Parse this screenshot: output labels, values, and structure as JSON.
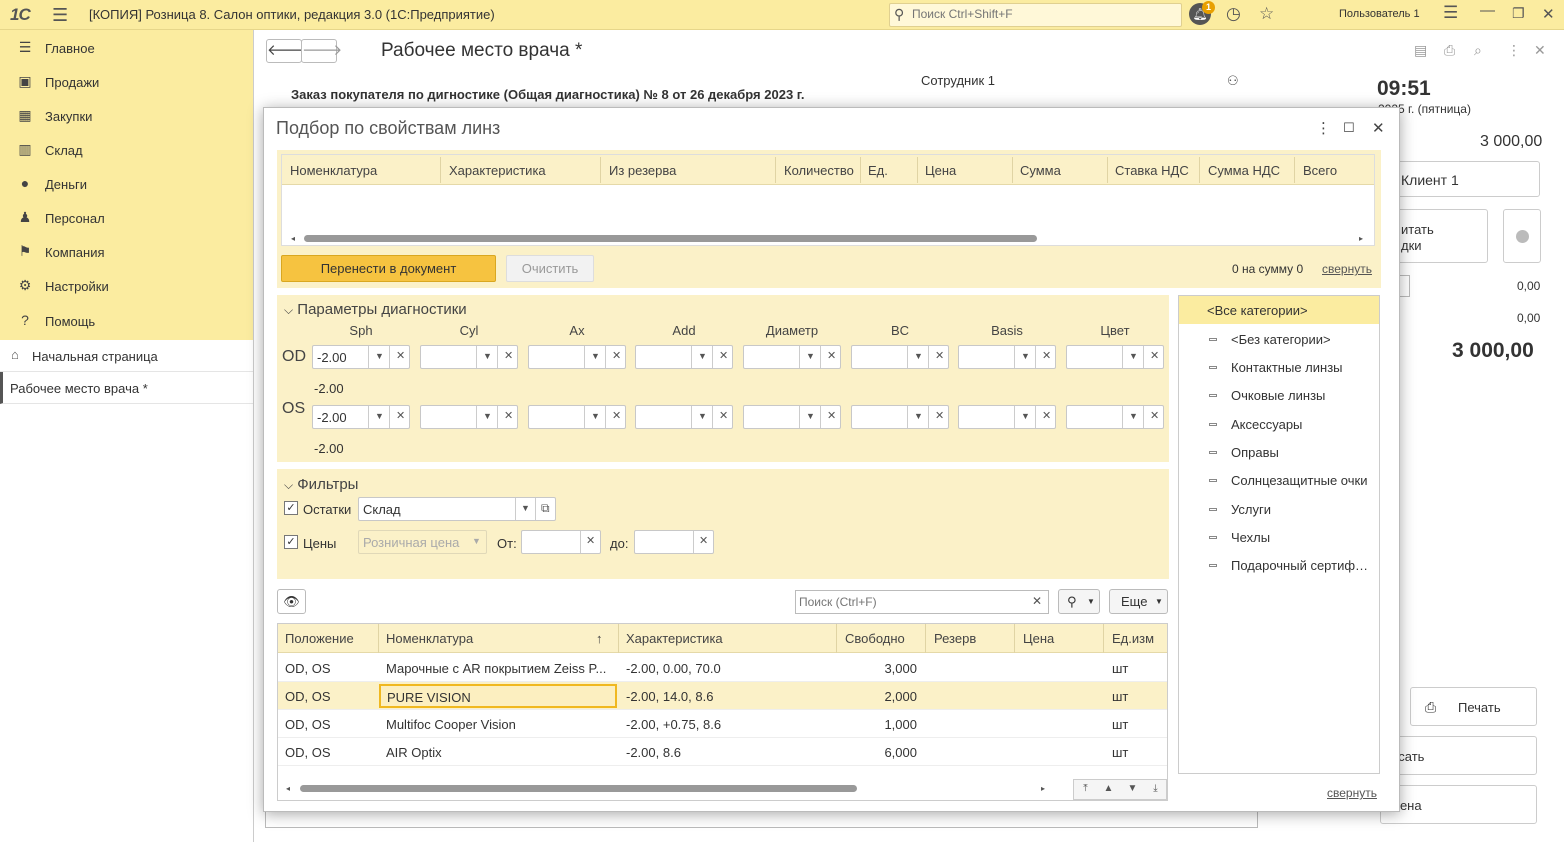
{
  "topbar": {
    "logo": "1С",
    "app_title": "[КОПИЯ] Розница 8. Салон оптики, редакция 3.0  (1С:Предприятие)",
    "search_placeholder": "Поиск Ctrl+Shift+F",
    "notifications_count": "1",
    "user": "Пользователь 1"
  },
  "sidebar": {
    "items": [
      {
        "label": "Главное",
        "icon": "menu-icon"
      },
      {
        "label": "Продажи",
        "icon": "basket-icon"
      },
      {
        "label": "Закупки",
        "icon": "purchases-icon"
      },
      {
        "label": "Склад",
        "icon": "warehouse-icon"
      },
      {
        "label": "Деньги",
        "icon": "money-icon"
      },
      {
        "label": "Персонал",
        "icon": "person-icon"
      },
      {
        "label": "Компания",
        "icon": "flag-icon"
      },
      {
        "label": "Настройки",
        "icon": "gear-icon"
      },
      {
        "label": "Помощь",
        "icon": "help-icon"
      }
    ],
    "open_windows": [
      {
        "label": "Начальная страница"
      },
      {
        "label": "Рабочее место врача *"
      }
    ]
  },
  "document": {
    "title": "Рабочее место врача *",
    "employee": "Сотрудник 1",
    "order_line": "Заказ покупателя по дигностике (Общая диагностика) № 8 от 26 декабря 2023 г.",
    "time": "09:51",
    "date": "2025 г. (пятница)",
    "amount_top": "3 000,00",
    "client": "Клиент 1",
    "discount_line1": "итать",
    "discount_line2": "дки",
    "zero1": "0,00",
    "zero2": "0,00",
    "total": "3 000,00",
    "print_label": "Печать",
    "pay_label": "исать",
    "cancel_label": "мена"
  },
  "modal": {
    "title": "Подбор по свойствам линз",
    "selected_table": {
      "columns": [
        "Номенклатура",
        "Характеристика",
        "Из резерва",
        "Количество",
        "Ед.",
        "Цена",
        "Сумма",
        "Ставка НДС",
        "Сумма НДС",
        "Всего"
      ]
    },
    "transfer_button": "Перенести в документ",
    "clear_button": "Очистить",
    "sum_text": "0 на сумму 0",
    "collapse_link": "свернуть",
    "params": {
      "title": "Параметры диагностики",
      "columns": [
        "Sph",
        "Cyl",
        "Ax",
        "Add",
        "Диаметр",
        "BC",
        "Basis",
        "Цвет"
      ],
      "od_label": "OD",
      "os_label": "OS",
      "od_sph": "-2.00",
      "od_sph_sub": "-2.00",
      "os_sph": "-2.00",
      "os_sph_sub": "-2.00"
    },
    "filters": {
      "title": "Фильтры",
      "stock_label": "Остатки",
      "stock_checked": true,
      "warehouse_value": "Склад",
      "prices_label": "Цены",
      "prices_checked": true,
      "price_type": "Розничная цена",
      "from_label": "От:",
      "to_label": "до:"
    },
    "list": {
      "search_placeholder": "Поиск (Ctrl+F)",
      "more_label": "Еще",
      "columns": [
        "Положение",
        "Номенклатура",
        "Характеристика",
        "Свободно",
        "Резерв",
        "Цена",
        "Ед.изм"
      ],
      "rows": [
        {
          "position": "OD, OS",
          "name": "Марочные с AR покрытием Zeiss P...",
          "char": "-2.00, 0.00, 70.0",
          "free": "3,000",
          "reserve": "",
          "price": "",
          "unit": "шт"
        },
        {
          "position": "OD, OS",
          "name": "PURE VISION",
          "char": "-2.00, 14.0, 8.6",
          "free": "2,000",
          "reserve": "",
          "price": "",
          "unit": "шт"
        },
        {
          "position": "OD, OS",
          "name": "Multifoc Cooper Vision",
          "char": "-2.00, +0.75, 8.6",
          "free": "1,000",
          "reserve": "",
          "price": "",
          "unit": "шт"
        },
        {
          "position": "OD, OS",
          "name": "AIR Optix",
          "char": "-2.00, 8.6",
          "free": "6,000",
          "reserve": "",
          "price": "",
          "unit": "шт"
        }
      ]
    },
    "categories": {
      "items": [
        "<Все категории>",
        "<Без категории>",
        "Контактные линзы",
        "Очковые линзы",
        "Аксессуары",
        "Оправы",
        "Солнцезащитные очки",
        "Услуги",
        "Чехлы",
        "Подарочный сертификат"
      ],
      "collapse_link": "свернуть"
    }
  },
  "colors": {
    "topbar": "#fbeca0",
    "panel": "#fbf1c8",
    "accent_button": "#f6c340"
  }
}
